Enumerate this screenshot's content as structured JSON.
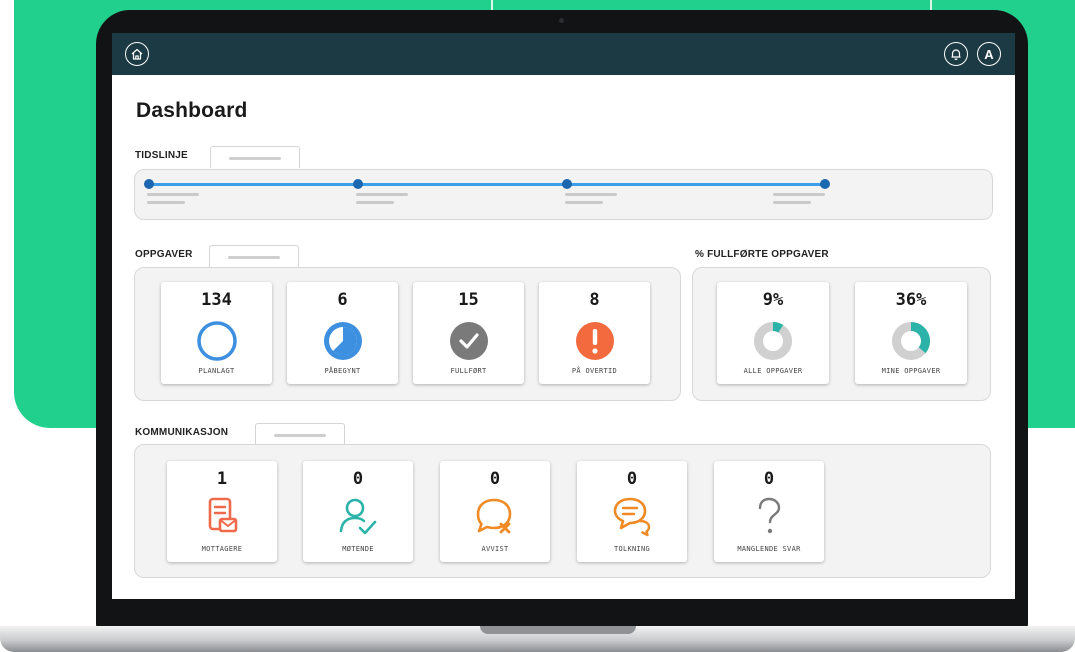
{
  "colors": {
    "background_green": "#22d08e",
    "topbar": "#1b3a44",
    "timeline_line": "#3da0e6",
    "timeline_dot": "#1b67b0",
    "blue": "#3d8fe0",
    "grey": "#7a7a7a",
    "red_orange": "#f26a3d",
    "teal": "#2bb3a9",
    "orange": "#f08a24",
    "coral": "#ef6a4b"
  },
  "topbar": {
    "home_icon": "home-icon",
    "notification_icon": "bell-icon",
    "avatar_initial": "A"
  },
  "page": {
    "title": "Dashboard"
  },
  "timeline": {
    "label": "TIDSLINJE",
    "points": 4
  },
  "tasks": {
    "label": "OPPGAVER",
    "cards": [
      {
        "count": "134",
        "label": "PLANLAGT",
        "icon": "empty-circle-icon"
      },
      {
        "count": "6",
        "label": "PÅBEGYNT",
        "icon": "progress-pie-icon"
      },
      {
        "count": "15",
        "label": "FULLFØRT",
        "icon": "check-circle-icon"
      },
      {
        "count": "8",
        "label": "PÅ OVERTID",
        "icon": "exclamation-circle-icon"
      }
    ]
  },
  "completion": {
    "label": "% FULLFØRTE OPPGAVER",
    "cards": [
      {
        "percent_text": "9%",
        "fraction": 0.09,
        "label": "ALLE OPPGAVER"
      },
      {
        "percent_text": "36%",
        "fraction": 0.36,
        "label": "MINE OPPGAVER"
      }
    ]
  },
  "communication": {
    "label": "KOMMUNIKASJON",
    "cards": [
      {
        "count": "1",
        "label": "MOTTAGERE",
        "icon": "document-message-icon"
      },
      {
        "count": "0",
        "label": "MØTENDE",
        "icon": "person-check-icon"
      },
      {
        "count": "0",
        "label": "AVVIST",
        "icon": "chat-declined-icon"
      },
      {
        "count": "0",
        "label": "TOLKNING",
        "icon": "chat-bubbles-icon"
      },
      {
        "count": "0",
        "label": "MANGLENDE SVAR",
        "icon": "question-mark-icon"
      }
    ]
  }
}
